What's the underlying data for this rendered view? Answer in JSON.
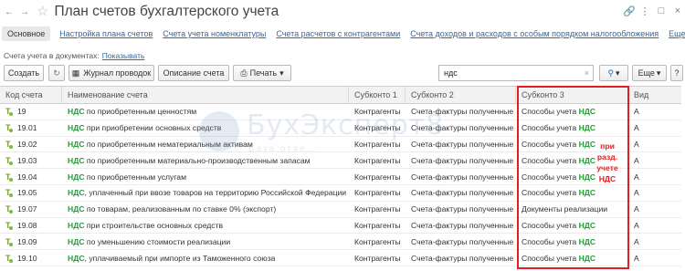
{
  "window": {
    "title": "План счетов бухгалтерского учета",
    "back_icon": "arrow-left-icon",
    "forward_icon": "arrow-right-icon",
    "star_icon": "star-icon"
  },
  "tabs": [
    {
      "label": "Основное",
      "active": true
    },
    {
      "label": "Настройка плана счетов"
    },
    {
      "label": "Счета учета номенклатуры"
    },
    {
      "label": "Счета расчетов с контрагентами"
    },
    {
      "label": "Счета доходов и расходов с особым порядком налогообложения"
    },
    {
      "label": "Еще"
    }
  ],
  "docs_line": {
    "label": "Счета учета в документах:",
    "link": "Показывать"
  },
  "toolbar": {
    "create": "Создать",
    "journal": "Журнал проводок",
    "description": "Описание счета",
    "print": "Печать",
    "search_value": "ндс",
    "more": "Еще"
  },
  "table": {
    "headers": [
      "Код счета",
      "Наименование счета",
      "Субконто 1",
      "Субконто 2",
      "Субконто 3",
      "Вид"
    ],
    "rows": [
      {
        "code": "19",
        "name_hl": "НДС",
        "name_rest": " по приобретенным ценностям",
        "sub1": "Контрагенты",
        "sub2": "Счета-фактуры полученные",
        "sub3": "Способы учета ",
        "sub3_hl": "НДС",
        "kind": "А"
      },
      {
        "code": "19.01",
        "name_hl": "НДС",
        "name_rest": " при приобретении основных средств",
        "sub1": "Контрагенты",
        "sub2": "Счета-фактуры полученные",
        "sub3": "Способы учета ",
        "sub3_hl": "НДС",
        "kind": "А"
      },
      {
        "code": "19.02",
        "name_hl": "НДС",
        "name_rest": " по приобретенным нематериальным активам",
        "sub1": "Контрагенты",
        "sub2": "Счета-фактуры полученные",
        "sub3": "Способы учета ",
        "sub3_hl": "НДС",
        "kind": "А"
      },
      {
        "code": "19.03",
        "name_hl": "НДС",
        "name_rest": " по приобретенным материально-производственным запасам",
        "sub1": "Контрагенты",
        "sub2": "Счета-фактуры полученные",
        "sub3": "Способы учета ",
        "sub3_hl": "НДС",
        "kind": "А"
      },
      {
        "code": "19.04",
        "name_hl": "НДС",
        "name_rest": " по приобретенным услугам",
        "sub1": "Контрагенты",
        "sub2": "Счета-фактуры полученные",
        "sub3": "Способы учета ",
        "sub3_hl": "НДС",
        "kind": "А"
      },
      {
        "code": "19.05",
        "name_hl": "НДС",
        "name_rest": ", уплаченный при ввозе товаров на территорию Российской Федерации",
        "sub1": "Контрагенты",
        "sub2": "Счета-фактуры полученные",
        "sub3": "Способы учета ",
        "sub3_hl": "НДС",
        "kind": "А"
      },
      {
        "code": "19.07",
        "name_hl": "НДС",
        "name_rest": " по товарам, реализованным по ставке 0% (экспорт)",
        "sub1": "Контрагенты",
        "sub2": "Счета-фактуры полученные",
        "sub3": "Документы реализации",
        "sub3_hl": "",
        "kind": "А"
      },
      {
        "code": "19.08",
        "name_hl": "НДС",
        "name_rest": " при строительстве основных средств",
        "sub1": "Контрагенты",
        "sub2": "Счета-фактуры полученные",
        "sub3": "Способы учета ",
        "sub3_hl": "НДС",
        "kind": "А"
      },
      {
        "code": "19.09",
        "name_hl": "НДС",
        "name_rest": " по уменьшению стоимости реализации",
        "sub1": "Контрагенты",
        "sub2": "Счета-фактуры полученные",
        "sub3": "Способы учета ",
        "sub3_hl": "НДС",
        "kind": "А"
      },
      {
        "code": "19.10",
        "name_hl": "НДС",
        "name_rest": ", уплачиваемый при импорте из Таможенного союза",
        "sub1": "Контрагенты",
        "sub2": "Счета-фактуры полученные",
        "sub3": "Способы учета ",
        "sub3_hl": "НДС",
        "kind": "А"
      }
    ]
  },
  "annotation": {
    "lines": [
      "при",
      "разд.",
      "учете",
      "НДС"
    ],
    "color": "#e02020"
  },
  "watermark": {
    "text": "БухЭксперт8",
    "sub": "База отве..."
  }
}
